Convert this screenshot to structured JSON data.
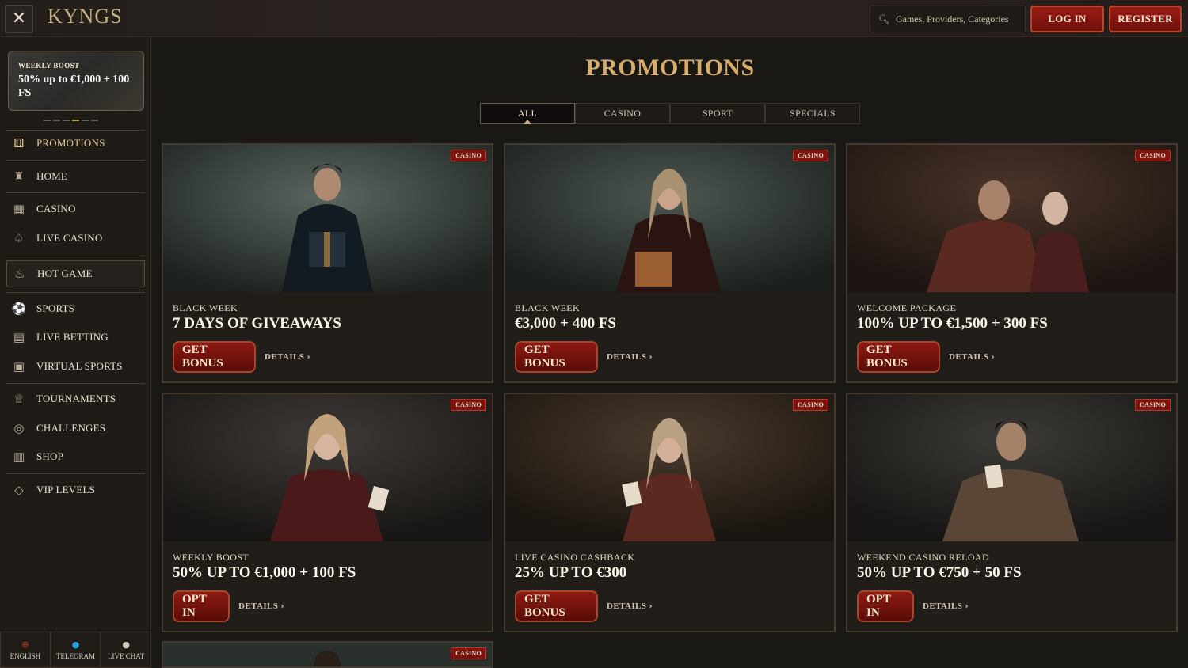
{
  "header": {
    "logo": "KYNGS",
    "search_placeholder": "Games, Providers, Categories",
    "login_label": "LOG IN",
    "register_label": "REGISTER"
  },
  "sidebar": {
    "boost": {
      "label": "WEEKLY BOOST",
      "text": "50% up to €1,000 + 100 FS"
    },
    "items": [
      {
        "label": "PROMOTIONS",
        "icon": "gift-icon"
      },
      {
        "label": "HOME",
        "icon": "castle-icon"
      },
      {
        "label": "CASINO",
        "icon": "slot-machine-icon"
      },
      {
        "label": "LIVE CASINO",
        "icon": "cards-icon"
      },
      {
        "label": "HOT GAME",
        "icon": "flame-icon"
      },
      {
        "label": "SPORTS",
        "icon": "soccer-ball-icon"
      },
      {
        "label": "LIVE BETTING",
        "icon": "live-icon"
      },
      {
        "label": "VIRTUAL SPORTS",
        "icon": "monitor-icon"
      },
      {
        "label": "TOURNAMENTS",
        "icon": "trophy-icon"
      },
      {
        "label": "CHALLENGES",
        "icon": "target-icon"
      },
      {
        "label": "SHOP",
        "icon": "shop-icon"
      },
      {
        "label": "VIP LEVELS",
        "icon": "diamond-icon"
      }
    ],
    "bottom": [
      {
        "label": "ENGLISH",
        "icon": "flag-icon"
      },
      {
        "label": "TELEGRAM",
        "icon": "telegram-icon"
      },
      {
        "label": "LIVE CHAT",
        "icon": "chat-icon"
      }
    ]
  },
  "main": {
    "title": "PROMOTIONS",
    "tabs": [
      "ALL",
      "CASINO",
      "SPORT",
      "SPECIALS"
    ],
    "active_tab": "ALL"
  },
  "promos": [
    {
      "badge": "CASINO",
      "subtitle": "BLACK WEEK",
      "title": "7 DAYS OF GIVEAWAYS",
      "button": "GET BONUS",
      "details": "DETAILS"
    },
    {
      "badge": "CASINO",
      "subtitle": "BLACK WEEK",
      "title": "€3,000 + 400 FS",
      "button": "GET BONUS",
      "details": "DETAILS"
    },
    {
      "badge": "CASINO",
      "subtitle": "WELCOME PACKAGE",
      "title": "100% UP TO €1,500 + 300 FS",
      "button": "GET BONUS",
      "details": "DETAILS"
    },
    {
      "badge": "CASINO",
      "subtitle": "WEEKLY BOOST",
      "title": "50% UP TO €1,000 + 100 FS",
      "button": "OPT IN",
      "details": "DETAILS"
    },
    {
      "badge": "CASINO",
      "subtitle": "LIVE CASINO CASHBACK",
      "title": "25% UP TO €300",
      "button": "GET BONUS",
      "details": "DETAILS"
    },
    {
      "badge": "CASINO",
      "subtitle": "WEEKEND CASINO RELOAD",
      "title": "50% UP TO €750 + 50 FS",
      "button": "OPT IN",
      "details": "DETAILS"
    },
    {
      "badge": "CASINO"
    }
  ],
  "colors": {
    "accent_gold": "#d8ad6a",
    "button_red": "#8c1a12",
    "background": "#1a1815"
  }
}
